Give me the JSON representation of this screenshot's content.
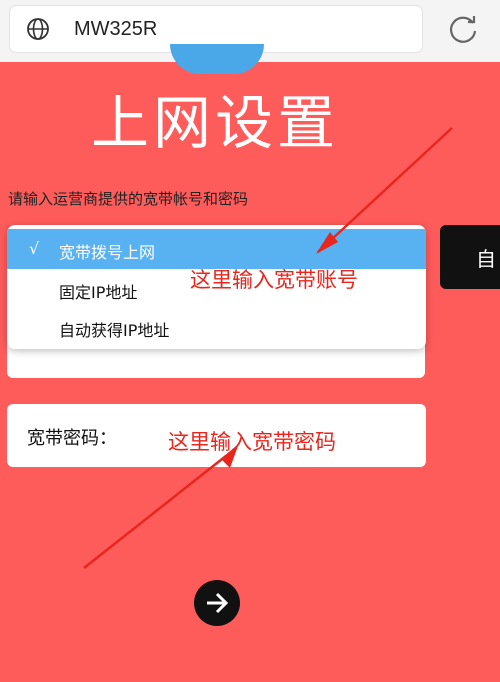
{
  "browser": {
    "url": "MW325R"
  },
  "page": {
    "title": "上网设置",
    "hint": "请输入运营商提供的宽带帐号和密码"
  },
  "dropdown": {
    "options": [
      {
        "label": "宽带拨号上网",
        "selected": true,
        "check": "√"
      },
      {
        "label": "固定IP地址",
        "selected": false
      },
      {
        "label": "自动获得IP地址",
        "selected": false
      }
    ]
  },
  "side_button": {
    "label": "自"
  },
  "password": {
    "label": "宽带密码："
  },
  "annotations": {
    "account": "这里输入宽带账号",
    "password": "这里输入宽带密码"
  },
  "colors": {
    "background": "#fe5b5b",
    "selected": "#58b1f0",
    "annotation": "#e8261e"
  },
  "icons": {
    "address": "globe-icon",
    "reload": "refresh-icon",
    "next": "arrow-right-icon"
  }
}
